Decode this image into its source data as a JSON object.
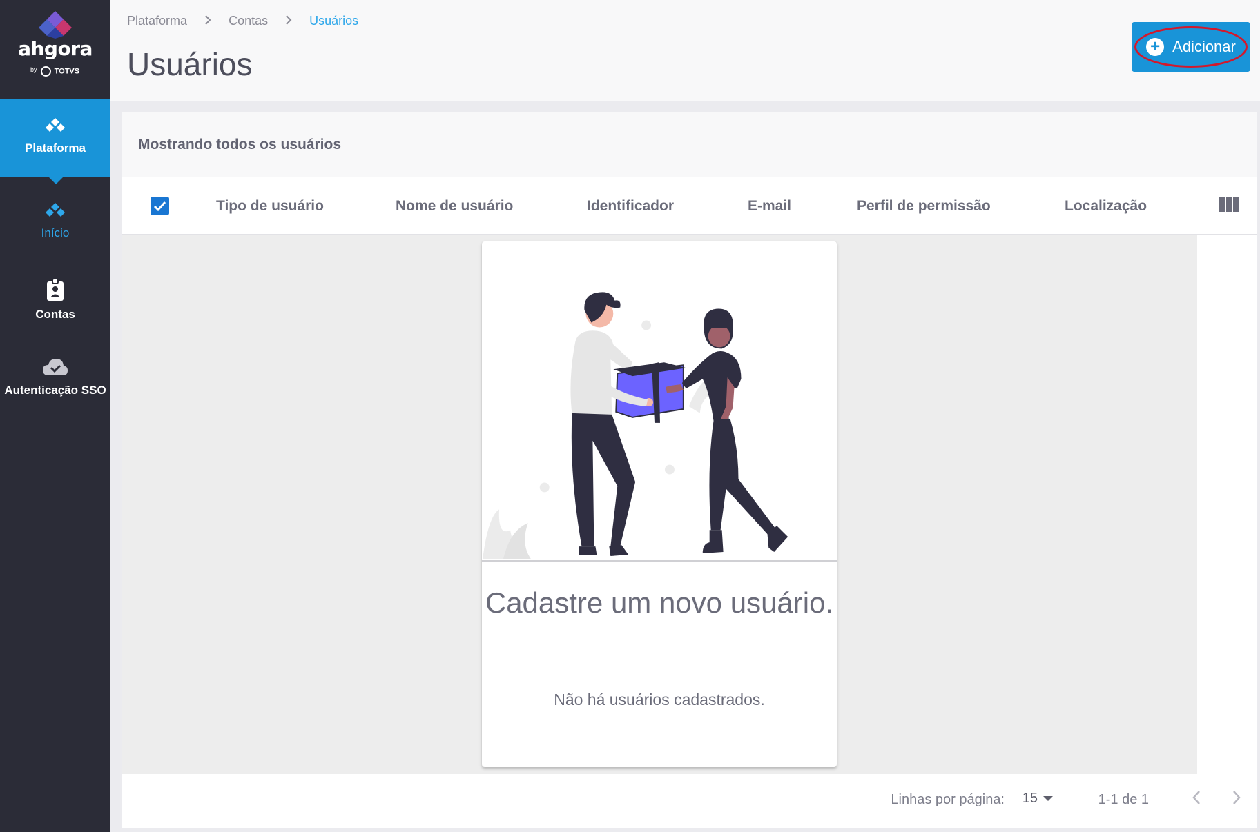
{
  "brand": {
    "name": "ahgora",
    "by": "by",
    "partner": "TOTVS"
  },
  "sidebar": {
    "items": [
      {
        "label": "Plataforma",
        "icon": "diamonds-icon",
        "active": true
      },
      {
        "label": "Início",
        "icon": "diamonds-icon"
      },
      {
        "label": "Contas",
        "icon": "badge-icon"
      },
      {
        "label": "Autenticação SSO",
        "icon": "cloud-check-icon"
      }
    ]
  },
  "header": {
    "breadcrumb": [
      "Plataforma",
      "Contas",
      "Usuários"
    ],
    "title": "Usuários",
    "add_label": "Adicionar"
  },
  "main": {
    "subtitle": "Mostrando todos os usuários",
    "columns": [
      "Tipo de usuário",
      "Nome de usuário",
      "Identificador",
      "E-mail",
      "Perfil de permissão",
      "Localização"
    ],
    "empty": {
      "title": "Cadastre um novo usuário.",
      "message": "Não há usuários cadastrados."
    }
  },
  "pagination": {
    "rows_label": "Linhas por página:",
    "rows_value": "15",
    "range": "1-1 de 1"
  },
  "colors": {
    "accent": "#1994d8",
    "sidebar": "#2b2c37",
    "highlight_ring": "#d3182b",
    "illustration_purple": "#6c63ff"
  }
}
